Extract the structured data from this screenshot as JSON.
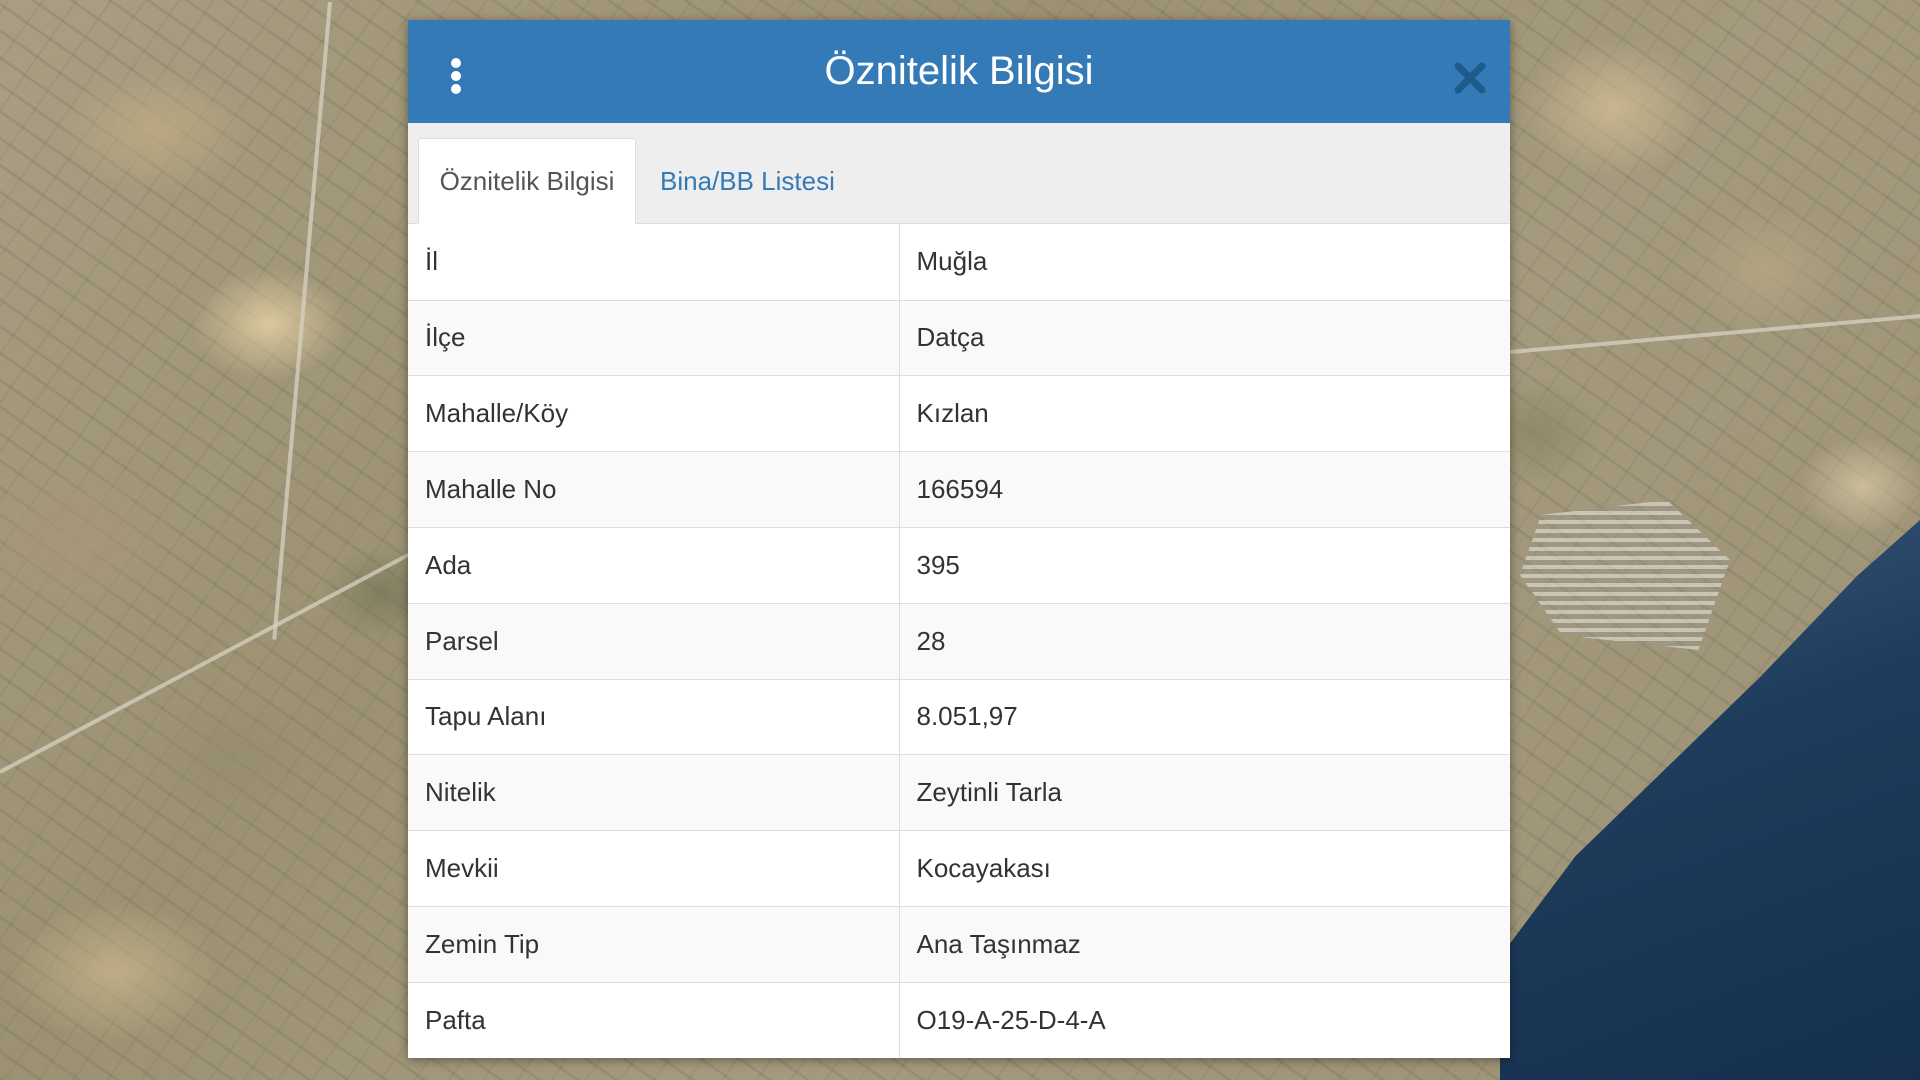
{
  "dialog": {
    "title": "Öznitelik Bilgisi",
    "menu_icon": "vertical-ellipsis-icon",
    "close_icon": "close-icon"
  },
  "tabs": [
    {
      "label": "Öznitelik Bilgisi",
      "active": true
    },
    {
      "label": "Bina/BB Listesi",
      "active": false
    }
  ],
  "attributes": [
    {
      "key": "İl",
      "value": "Muğla"
    },
    {
      "key": "İlçe",
      "value": "Datça"
    },
    {
      "key": "Mahalle/Köy",
      "value": "Kızlan"
    },
    {
      "key": "Mahalle No",
      "value": "166594"
    },
    {
      "key": "Ada",
      "value": "395"
    },
    {
      "key": "Parsel",
      "value": "28"
    },
    {
      "key": "Tapu Alanı",
      "value": "8.051,97"
    },
    {
      "key": "Nitelik",
      "value": "Zeytinli Tarla"
    },
    {
      "key": "Mevkii",
      "value": "Kocayakası"
    },
    {
      "key": "Zemin Tip",
      "value": "Ana Taşınmaz"
    },
    {
      "key": "Pafta",
      "value": "O19-A-25-D-4-A"
    }
  ],
  "colors": {
    "header": "#337ab7",
    "link": "#337ab7",
    "sea": "#1f3c5c"
  }
}
